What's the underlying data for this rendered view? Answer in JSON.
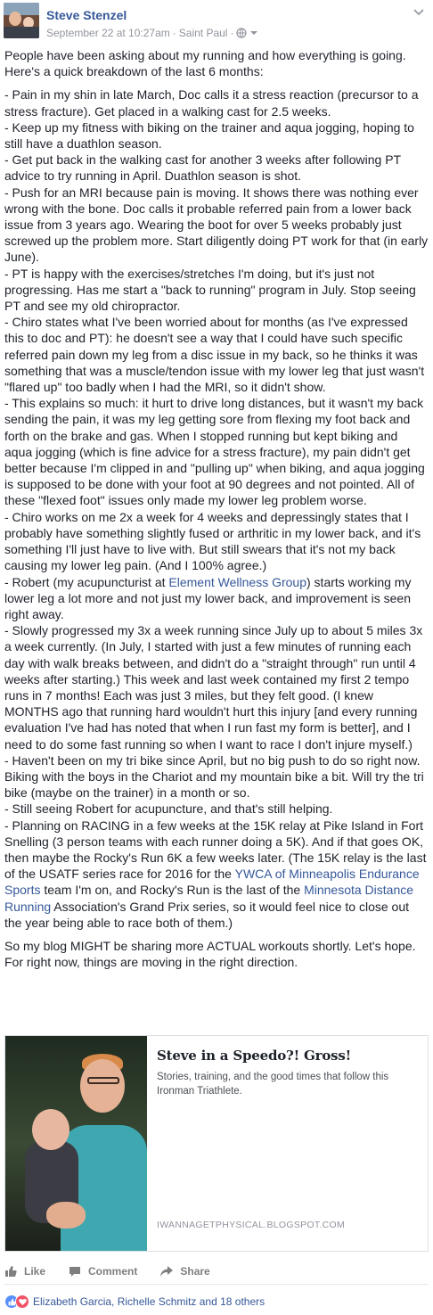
{
  "header": {
    "author": "Steve Stenzel",
    "date": "September 22 at 10:27am",
    "separator": "·",
    "location": "Saint Paul",
    "separator2": "·",
    "icons": [
      "globe-icon",
      "dropdown-chevron-icon",
      "post-menu-chevron-icon"
    ]
  },
  "post": {
    "intro": "People have been asking about my running and how everything is going. Here's a quick breakdown of the last 6 months:",
    "items": [
      "- Pain in my shin in late March, Doc calls it a stress reaction (precursor to a stress fracture). Get placed in a walking cast for 2.5 weeks.",
      "- Keep up my fitness with biking on the trainer and aqua jogging, hoping to still have a duathlon season.",
      "- Get put back in the walking cast for another 3 weeks after following PT advice to try running in April. Duathlon season is shot.",
      "- Push for an MRI because pain is moving. It shows there was nothing ever wrong with the bone. Doc calls it probable referred pain from a lower back issue from 3 years ago. Wearing the boot for over 5 weeks probably just screwed up the problem more. Start diligently doing PT work for that (in early June).",
      "- PT is happy with the exercises/stretches I'm doing, but it's just not progressing. Has me start a \"back to running\" program in July. Stop seeing PT and see my old chiropractor.",
      "- Chiro states what I've been worried about for months (as I've expressed this to doc and PT): he doesn't see a way that I could have such specific referred pain down my leg from a disc issue in my back, so he thinks it was something that was a muscle/tendon issue with my lower leg that just wasn't \"flared up\" too badly when I had the MRI, so it didn't show.",
      "- This explains so much: it hurt to drive long distances, but it wasn't my back sending the pain, it was my leg getting sore from flexing my foot back and forth on the brake and gas. When I stopped running but kept biking and aqua jogging (which is fine advice for a stress fracture), my pain didn't get better because I'm clipped in and \"pulling up\" when biking, and aqua jogging is supposed to be done with your foot at 90 degrees and not pointed. All of these \"flexed foot\" issues only made my lower leg problem worse.",
      "- Chiro works on me 2x a week for 4 weeks and depressingly states that I probably have something slightly fused or arthritic in my lower back, and it's something I'll just have to live with. But still swears that it's not my back causing my lower leg pain. (And I 100% agree.)"
    ],
    "robert_pre": "- Robert (my acupuncturist at ",
    "robert_link": "Element Wellness Group",
    "robert_post": ") starts working my lower leg a lot more and not just my lower back, and improvement is seen right away.",
    "items2": [
      "- Slowly progressed my 3x a week running since July up to about 5 miles 3x a week currently. (In July, I started with just a few minutes of running each day with walk breaks between, and didn't do a \"straight through\" run until 4 weeks after starting.) This week and last week contained my first 2 tempo runs in 7 months! Each was just 3 miles, but they felt good. (I knew MONTHS ago that running hard wouldn't hurt this injury [and every running evaluation I've had has noted that when I run fast my form is better], and I need to do some fast running so when I want to race I don't injure myself.)",
      "- Haven't been on my tri bike since April, but no big push to do so right now. Biking with the boys in the Chariot and my mountain bike a bit. Will try the tri bike (maybe on the trainer) in a month or so.",
      "- Still seeing Robert for acupuncture, and that's still helping."
    ],
    "racing_a": "- Planning on RACING in a few weeks at the 15K relay at Pike Island in Fort Snelling (3 person teams with each runner doing a 5K). And if that goes OK, then maybe the Rocky's Run 6K a few weeks later. (The 15K relay is the last of the USATF series race for 2016 for the ",
    "racing_link1": "YWCA of Minneapolis Endurance Sports",
    "racing_b": " team I'm on, and Rocky's Run is the last of the ",
    "racing_link2": "Minnesota Distance Running",
    "racing_c": " Association's Grand Prix series, so it would feel nice to close out the year being able to race both of them.)",
    "closing": "So my blog MIGHT be sharing more ACTUAL workouts shortly. Let's hope. For right now, things are moving in the right direction."
  },
  "card": {
    "title": "Steve in a Speedo?! Gross!",
    "description": "Stories, training, and the good times that follow this Ironman Triathlete.",
    "domain": "IWANNAGETPHYSICAL.BLOGSPOT.COM"
  },
  "actions": {
    "like": "Like",
    "comment": "Comment",
    "share": "Share"
  },
  "reactions": {
    "summary": "Elizabeth Garcia, Richelle Schmitz and 18 others",
    "types": [
      "like",
      "love"
    ]
  },
  "colors": {
    "link": "#365899",
    "text": "#1d2129",
    "meta": "#90949c",
    "like_blue": "#5890ff",
    "love_red": "#f25268"
  }
}
